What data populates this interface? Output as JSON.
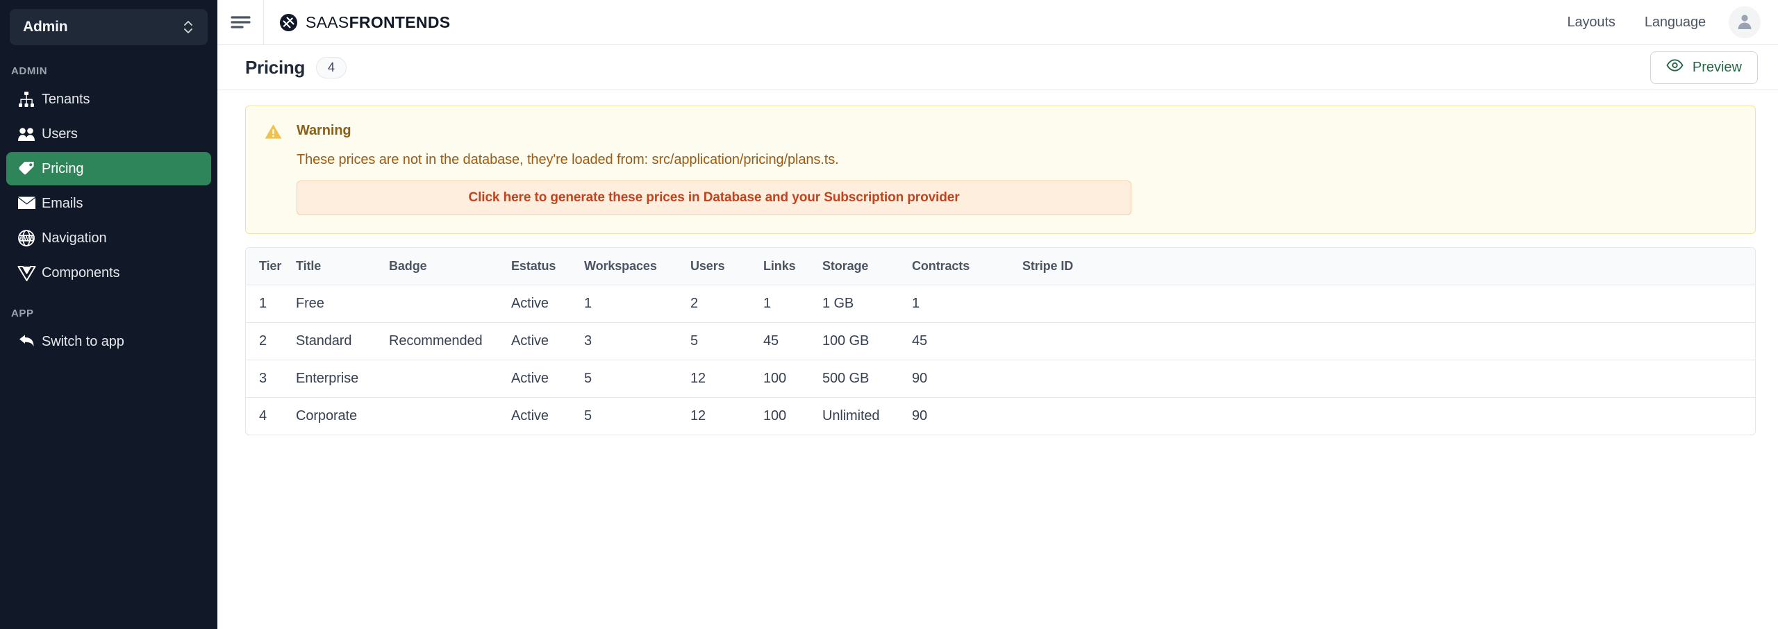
{
  "sidebar": {
    "org_switcher": {
      "label": "Admin",
      "icon": "chevron-up-down-icon"
    },
    "sections": [
      {
        "label": "ADMIN",
        "items": [
          {
            "label": "Tenants",
            "icon": "sitemap-icon",
            "active": false
          },
          {
            "label": "Users",
            "icon": "users-icon",
            "active": false
          },
          {
            "label": "Pricing",
            "icon": "price-tag-icon",
            "active": true
          },
          {
            "label": "Emails",
            "icon": "envelope-icon",
            "active": false
          },
          {
            "label": "Navigation",
            "icon": "www-globe-icon",
            "active": false
          },
          {
            "label": "Components",
            "icon": "vue-logo-icon",
            "active": false
          }
        ]
      },
      {
        "label": "APP",
        "items": [
          {
            "label": "Switch to app",
            "icon": "arrow-back-icon",
            "active": false
          }
        ]
      }
    ]
  },
  "topbar": {
    "menu_icon": "hamburger-icon",
    "brand": {
      "icon": "saasfrontends-logo-icon",
      "text_light": "SAAS",
      "text_bold": "FRONTENDS"
    },
    "links": [
      {
        "label": "Layouts"
      },
      {
        "label": "Language"
      }
    ],
    "avatar_icon": "user-avatar-icon"
  },
  "page_header": {
    "title": "Pricing",
    "count": "4",
    "preview_button": {
      "label": "Preview",
      "icon": "eye-icon"
    }
  },
  "warning": {
    "icon": "warning-triangle-icon",
    "title": "Warning",
    "text": "These prices are not in the database, they're loaded from: src/application/pricing/plans.ts.",
    "action_label": "Click here to generate these prices in Database and your Subscription provider"
  },
  "table": {
    "columns": [
      "Tier",
      "Title",
      "Badge",
      "Estatus",
      "Workspaces",
      "Users",
      "Links",
      "Storage",
      "Contracts",
      "Stripe ID"
    ],
    "rows": [
      {
        "tier": "1",
        "title": "Free",
        "badge": "",
        "estatus": "Active",
        "workspaces": "1",
        "users": "2",
        "links": "1",
        "storage": "1 GB",
        "contracts": "1",
        "stripe_id": ""
      },
      {
        "tier": "2",
        "title": "Standard",
        "badge": "Recommended",
        "estatus": "Active",
        "workspaces": "3",
        "users": "5",
        "links": "45",
        "storage": "100 GB",
        "contracts": "45",
        "stripe_id": ""
      },
      {
        "tier": "3",
        "title": "Enterprise",
        "badge": "",
        "estatus": "Active",
        "workspaces": "5",
        "users": "12",
        "links": "100",
        "storage": "500 GB",
        "contracts": "90",
        "stripe_id": ""
      },
      {
        "tier": "4",
        "title": "Corporate",
        "badge": "",
        "estatus": "Active",
        "workspaces": "5",
        "users": "12",
        "links": "100",
        "storage": "Unlimited",
        "contracts": "90",
        "stripe_id": ""
      }
    ]
  },
  "colors": {
    "sidebar_bg": "#111827",
    "sidebar_active": "#2f855a",
    "accent_green": "#276749",
    "warning_bg": "#fdfcee",
    "warning_border": "#f0e3a8",
    "warning_title_text": "#8a6116",
    "warning_body_text": "#9a5b15",
    "action_bg": "#fdeedd",
    "action_text": "#c0441f",
    "table_header_bg": "#f9fafb",
    "border": "#e5e7eb"
  }
}
